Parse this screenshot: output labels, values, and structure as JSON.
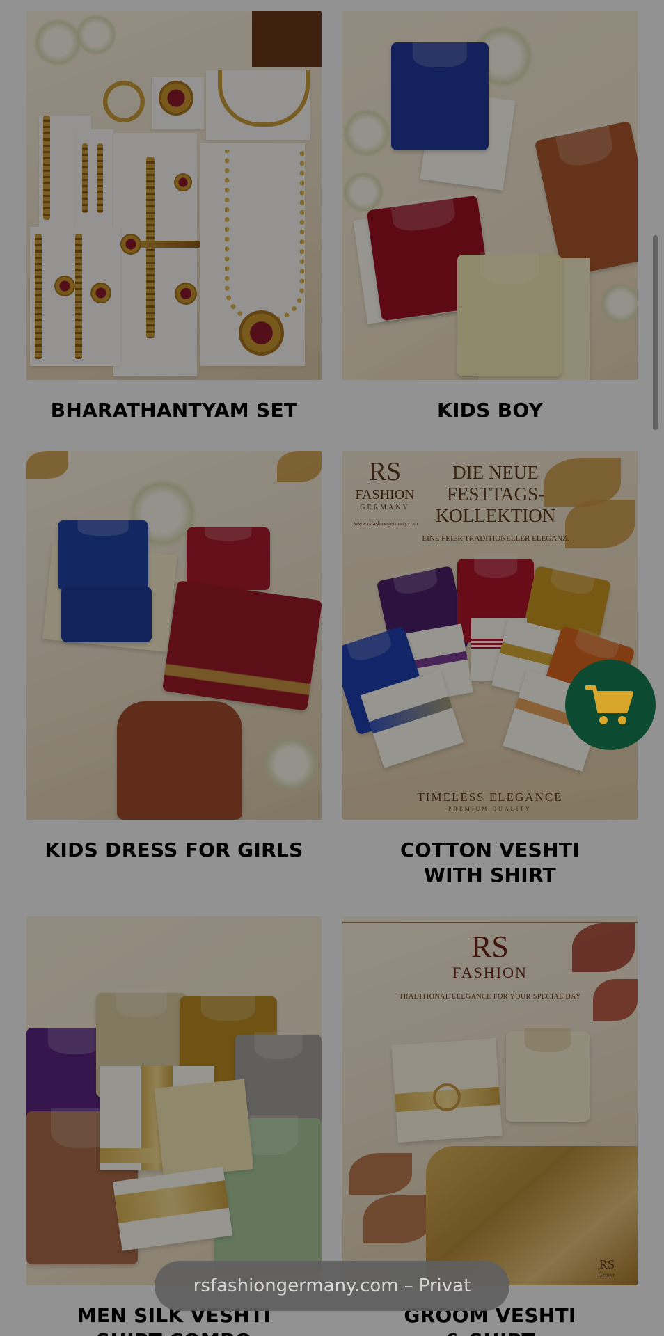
{
  "products": [
    {
      "name": "BHARATHANTYAM SET",
      "lines": [
        "BHARATHANTYAM SET"
      ]
    },
    {
      "name": "KIDS BOY",
      "lines": [
        "KIDS BOY"
      ]
    },
    {
      "name": "KIDS DRESS FOR GIRLS",
      "lines": [
        "KIDS DRESS FOR GIRLS"
      ]
    },
    {
      "name": "COTTON VESHTI WITH SHIRT",
      "lines": [
        "COTTON VESHTI",
        "WITH SHIRT"
      ]
    },
    {
      "name": "MEN SILK VESHTI SHIRT COMBO",
      "lines": [
        "MEN SILK VESHTI",
        "SHIRT COMBO"
      ]
    },
    {
      "name": "GROOM VESHTI & SHIRT",
      "lines": [
        "GROOM VESHTI",
        "& SHIRT"
      ]
    }
  ],
  "festive_poster": {
    "brand_initials": "RS",
    "brand_name": "FASHION",
    "brand_country": "GERMANY",
    "website": "www.rsfashiongermany.com",
    "headline": [
      "DIE NEUE",
      "FESTTAGS-",
      "KOLLEKTION"
    ],
    "subline": "EINE FEIER TRADITIONELLER ELEGANZ.",
    "footer": "TIMELESS ELEGANCE",
    "footer_sub": "PREMIUM QUALITY"
  },
  "groom_poster": {
    "brand_initials": "RS",
    "brand_name": "FASHION",
    "tagline": "TRADITIONAL ELEGANCE FOR YOUR SPECIAL DAY",
    "badge_initials": "RS",
    "badge_sub": "Groom"
  },
  "cart": {
    "icon": "shopping-cart-icon",
    "color": "#0c4a32",
    "icon_color": "#d9a62c"
  },
  "browser": {
    "url": "rsfashiongermany.com",
    "separator": "–",
    "mode": "Privat"
  }
}
